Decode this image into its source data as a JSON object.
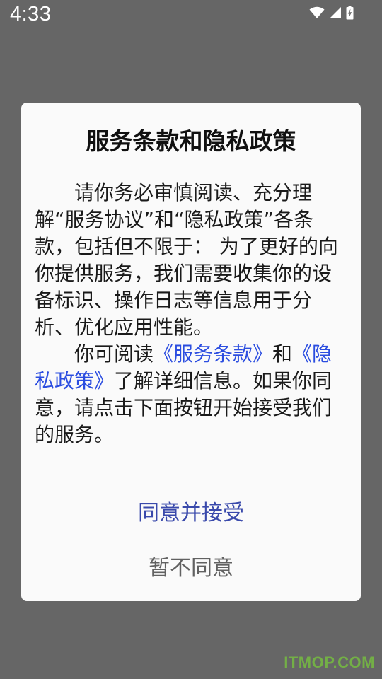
{
  "status_bar": {
    "time": "4:33",
    "icons": [
      "wifi-icon",
      "cell-signal-icon",
      "battery-charging-icon"
    ]
  },
  "dialog": {
    "title": "服务条款和隐私政策",
    "paragraph1": "请你务必审慎阅读、充分理解“服务协议”和“隐私政策”各条款，包括但不限于： 为了更好的向你提供服务，我们需要收集你的设备标识、操作日志等信息用于分析、优化应用性能。",
    "paragraph2": {
      "prefix": "你可阅读",
      "terms_link": "《服务条款》",
      "and": "和",
      "privacy_link": "《隐私政策》",
      "suffix": "了解详细信息。如果你同意，请点击下面按钮开始接受我们的服务。"
    },
    "agree_label": "同意并接受",
    "decline_label": "暂不同意"
  },
  "watermark": "ITMOP.COM",
  "colors": {
    "backdrop": "#666666",
    "dialog_bg": "#fafafa",
    "link": "#2b4de0",
    "agree": "#3949ab",
    "decline": "#616161"
  }
}
